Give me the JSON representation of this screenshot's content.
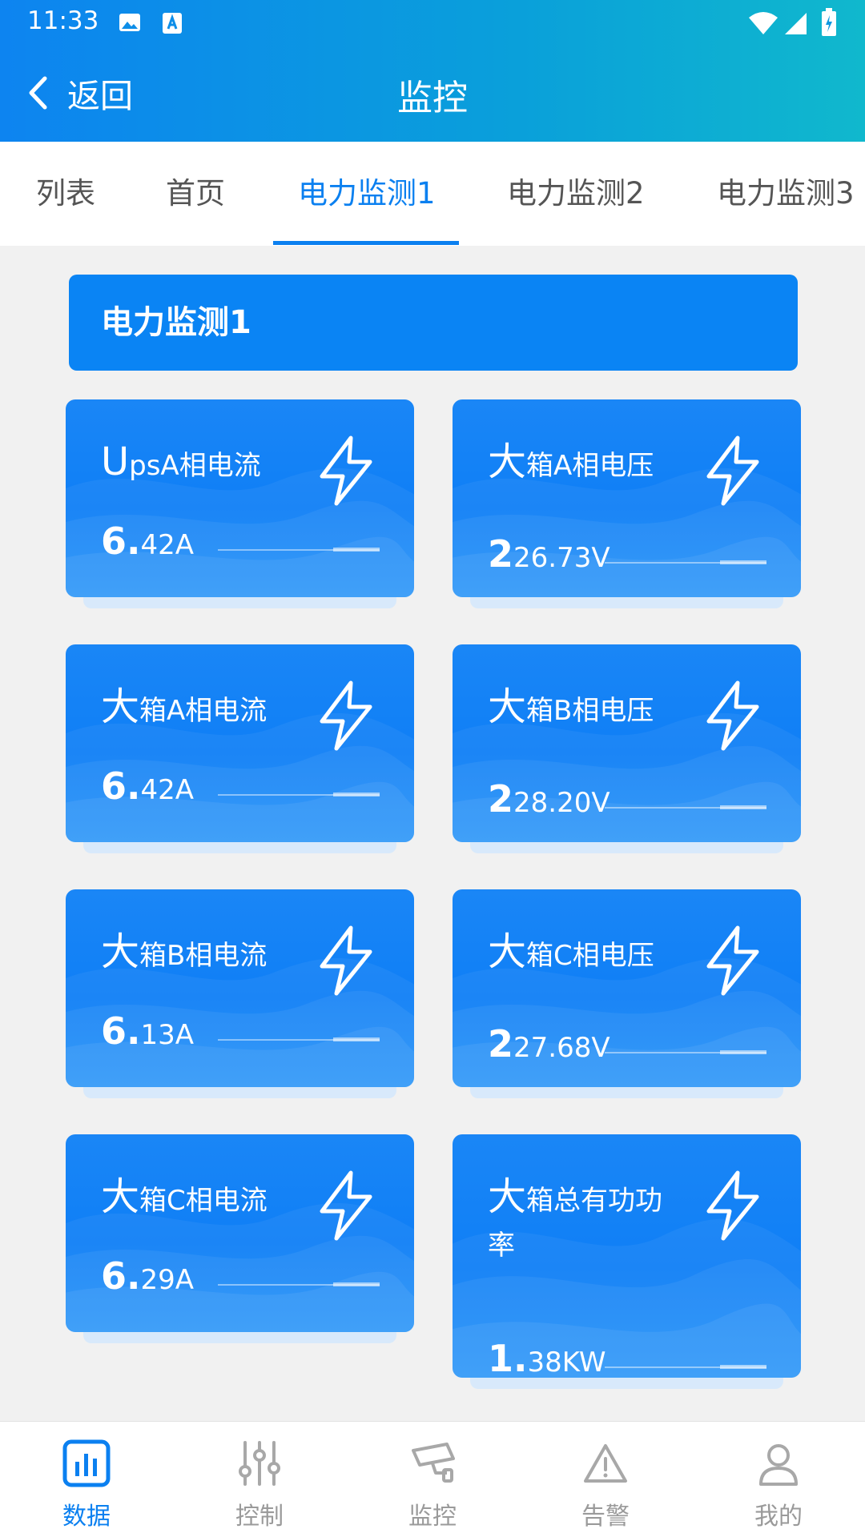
{
  "status_bar": {
    "time": "11:33"
  },
  "nav": {
    "back_label": "返回",
    "title": "监控"
  },
  "tabs": [
    {
      "label": "列表",
      "active": false
    },
    {
      "label": "首页",
      "active": false
    },
    {
      "label": "电力监测1",
      "active": true
    },
    {
      "label": "电力监测2",
      "active": false
    },
    {
      "label": "电力监测3",
      "active": false
    }
  ],
  "section": {
    "title": "电力监测1"
  },
  "cards": [
    {
      "label_first": "U",
      "label_rest": "psA相电流",
      "value_first": "6.",
      "value_rest": "42A"
    },
    {
      "label_first": "大",
      "label_rest": "箱A相电压",
      "value_first": "2",
      "value_rest": "26.73V"
    },
    {
      "label_first": "大",
      "label_rest": "箱A相电流",
      "value_first": "6.",
      "value_rest": "42A"
    },
    {
      "label_first": "大",
      "label_rest": "箱B相电压",
      "value_first": "2",
      "value_rest": "28.20V"
    },
    {
      "label_first": "大",
      "label_rest": "箱B相电流",
      "value_first": "6.",
      "value_rest": "13A"
    },
    {
      "label_first": "大",
      "label_rest": "箱C相电压",
      "value_first": "2",
      "value_rest": "27.68V"
    },
    {
      "label_first": "大",
      "label_rest": "箱C相电流",
      "value_first": "6.",
      "value_rest": "29A"
    },
    {
      "label_first": "大",
      "label_rest": "箱总有功功率",
      "value_first": "1.",
      "value_rest": "38KW"
    }
  ],
  "bottom_nav": [
    {
      "label": "数据",
      "icon": "bar-chart-icon",
      "active": true
    },
    {
      "label": "控制",
      "icon": "sliders-icon",
      "active": false
    },
    {
      "label": "监控",
      "icon": "camera-icon",
      "active": false
    },
    {
      "label": "告警",
      "icon": "warning-icon",
      "active": false
    },
    {
      "label": "我的",
      "icon": "user-icon",
      "active": false
    }
  ],
  "colors": {
    "primary": "#0b80f0",
    "card": "#0f7ff6",
    "inactive": "#9a9a9a"
  }
}
